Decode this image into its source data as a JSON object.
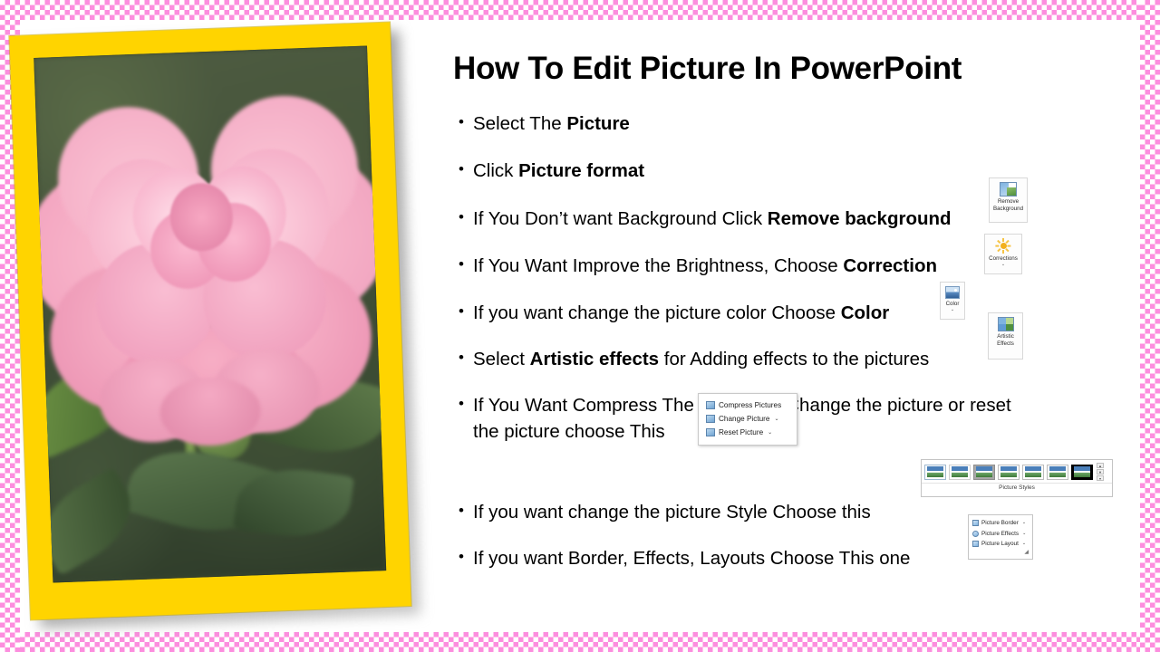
{
  "slide": {
    "title": "How To Edit Picture In PowerPoint",
    "border_color": "#fc8ede",
    "frame_color": "#ffd400",
    "bullet_glyph": "•"
  },
  "bullets": [
    {
      "id": "select-the-picture",
      "pre": "Select The ",
      "bold": "Picture",
      "post": ""
    },
    {
      "id": "click-picture-format",
      "pre": "Click ",
      "bold": "Picture format",
      "post": ""
    },
    {
      "id": "remove-background",
      "pre": "If You Don’t want Background Click ",
      "bold": "Remove background",
      "post": ""
    },
    {
      "id": "corrections",
      "pre": "If You Want Improve the Brightness, Choose ",
      "bold": "Correction",
      "post": ""
    },
    {
      "id": "color",
      "pre": "If you want change the picture color Choose ",
      "bold": "Color",
      "post": ""
    },
    {
      "id": "artistic-effects",
      "pre": "Select ",
      "bold": "Artistic effects",
      "post": " for  Adding effects to the pictures"
    },
    {
      "id": "compress-change-reset",
      "pre": "If You Want Compress The images or Change the picture or reset the picture choose This ",
      "bold": "",
      "post": ""
    },
    {
      "id": "picture-style",
      "pre": "If you want change the picture Style Choose this",
      "bold": "",
      "post": ""
    },
    {
      "id": "border-effects-layouts",
      "pre": "If you want Border, Effects, Layouts Choose This one",
      "bold": "",
      "post": ""
    }
  ],
  "ribbon": {
    "remove_background": {
      "line1": "Remove",
      "line2": "Background"
    },
    "corrections": {
      "label": "Corrections",
      "caret": "⌄"
    },
    "color": {
      "label": "Color",
      "caret": "⌄"
    },
    "artistic_effects": {
      "line1": "Artistic",
      "line2": "Effects",
      "caret": "⌄"
    }
  },
  "compress_menu": {
    "items": [
      {
        "label": "Compress Pictures",
        "caret": ""
      },
      {
        "label": "Change Picture",
        "caret": "⌄"
      },
      {
        "label": "Reset Picture",
        "caret": "⌄"
      }
    ]
  },
  "picture_styles": {
    "label": "Picture Styles",
    "thumb_count": 7,
    "scroll": {
      "up": "▲",
      "down": "▼",
      "more": "▾"
    }
  },
  "border_effects_layout": {
    "items": [
      {
        "label": "Picture Border",
        "caret": "⌄"
      },
      {
        "label": "Picture Effects",
        "caret": "⌄"
      },
      {
        "label": "Picture Layout",
        "caret": "⌄"
      }
    ],
    "corner": "◢"
  }
}
